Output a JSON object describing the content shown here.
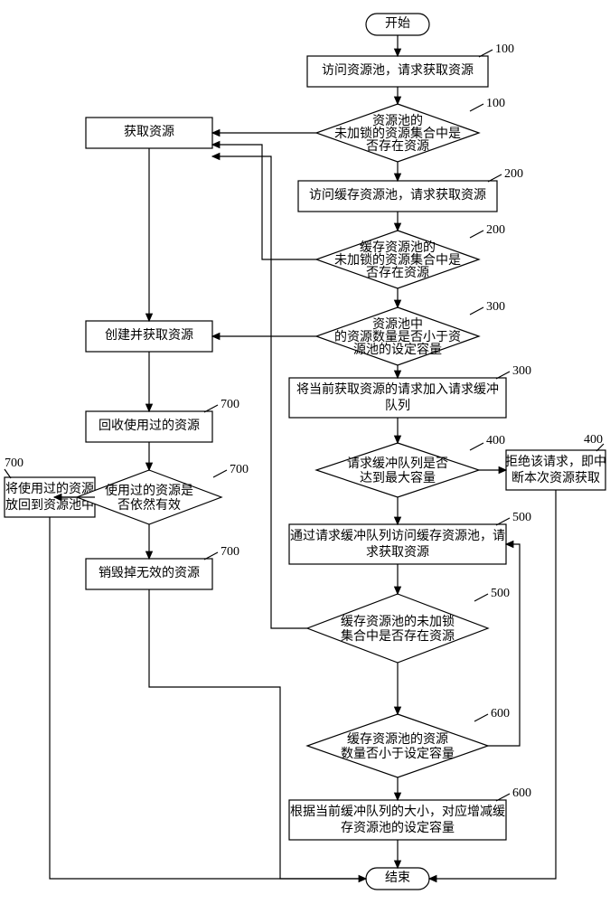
{
  "terminals": {
    "start": "开始",
    "end": "结束"
  },
  "boxes": {
    "b100_access": "访问资源池，请求获取资源",
    "b_get_resource": "获取资源",
    "b200_access": "访问缓存资源池，请求获取资源",
    "b_create_get": "创建并获取资源",
    "b300_queue": "将当前获取资源的请求加入请求缓冲\n队列",
    "b700_recycle": "回收使用过的资源",
    "b400_reject": "拒绝该请求，即中\n断本次资源获取",
    "b500_via_buffer": "通过请求缓冲队列访问缓存资源池，请\n求获取资源",
    "b700_putback": "将使用过的资源\n放回到资源池中",
    "b700_destroy": "销毁掉无效的资源",
    "b600_adjust": "根据当前缓冲队列的大小，对应增减缓\n存资源池的设定容量"
  },
  "decisions": {
    "d100": "资源池的\n未加锁的资源集合中是\n否存在资源",
    "d200": "缓存资源池的\n未加锁的资源集合中是\n否存在资源",
    "d300": "资源池中\n的资源数量是否小于资\n源池的设定容量",
    "d400": "请求缓冲队列是否\n达到最大容量",
    "d700_valid": "使用过的资源是\n否依然有效",
    "d500": "缓存资源池的未加锁\n集合中是否存在资源",
    "d600": "缓存资源池的资源\n数量否小于设定容量"
  },
  "step_labels": {
    "n100": "100",
    "n200": "200",
    "n300": "300",
    "n400": "400",
    "n500": "500",
    "n600": "600",
    "n700": "700"
  },
  "chart_data": {
    "type": "flowchart",
    "nodes": [
      {
        "id": "start",
        "kind": "terminal",
        "label_key": "terminals.start"
      },
      {
        "id": "b100_access",
        "kind": "process",
        "label_key": "boxes.b100_access",
        "step": "100"
      },
      {
        "id": "d100",
        "kind": "decision",
        "label_key": "decisions.d100",
        "step": "100"
      },
      {
        "id": "b_get_resource",
        "kind": "process",
        "label_key": "boxes.b_get_resource"
      },
      {
        "id": "b200_access",
        "kind": "process",
        "label_key": "boxes.b200_access",
        "step": "200"
      },
      {
        "id": "d200",
        "kind": "decision",
        "label_key": "decisions.d200",
        "step": "200"
      },
      {
        "id": "d300",
        "kind": "decision",
        "label_key": "decisions.d300",
        "step": "300"
      },
      {
        "id": "b_create_get",
        "kind": "process",
        "label_key": "boxes.b_create_get"
      },
      {
        "id": "b300_queue",
        "kind": "process",
        "label_key": "boxes.b300_queue",
        "step": "300"
      },
      {
        "id": "b700_recycle",
        "kind": "process",
        "label_key": "boxes.b700_recycle",
        "step": "700"
      },
      {
        "id": "d400",
        "kind": "decision",
        "label_key": "decisions.d400",
        "step": "400"
      },
      {
        "id": "b400_reject",
        "kind": "process",
        "label_key": "boxes.b400_reject",
        "step": "400"
      },
      {
        "id": "d700_valid",
        "kind": "decision",
        "label_key": "decisions.d700_valid",
        "step": "700"
      },
      {
        "id": "b500_via_buffer",
        "kind": "process",
        "label_key": "boxes.b500_via_buffer",
        "step": "500"
      },
      {
        "id": "b700_putback",
        "kind": "process",
        "label_key": "boxes.b700_putback",
        "step": "700"
      },
      {
        "id": "b700_destroy",
        "kind": "process",
        "label_key": "boxes.b700_destroy",
        "step": "700"
      },
      {
        "id": "d500",
        "kind": "decision",
        "label_key": "decisions.d500",
        "step": "500"
      },
      {
        "id": "d600",
        "kind": "decision",
        "label_key": "decisions.d600",
        "step": "600"
      },
      {
        "id": "b600_adjust",
        "kind": "process",
        "label_key": "boxes.b600_adjust",
        "step": "600"
      },
      {
        "id": "end",
        "kind": "terminal",
        "label_key": "terminals.end"
      }
    ],
    "edges": [
      {
        "from": "start",
        "to": "b100_access"
      },
      {
        "from": "b100_access",
        "to": "d100"
      },
      {
        "from": "d100",
        "to": "b_get_resource",
        "branch": "yes"
      },
      {
        "from": "d100",
        "to": "b200_access",
        "branch": "no"
      },
      {
        "from": "b200_access",
        "to": "d200"
      },
      {
        "from": "d200",
        "to": "b_get_resource",
        "branch": "yes"
      },
      {
        "from": "d200",
        "to": "d300",
        "branch": "no"
      },
      {
        "from": "d300",
        "to": "b_create_get",
        "branch": "yes"
      },
      {
        "from": "d300",
        "to": "b300_queue",
        "branch": "no"
      },
      {
        "from": "b_create_get",
        "to": "b700_recycle"
      },
      {
        "from": "b_get_resource",
        "to": "b700_recycle"
      },
      {
        "from": "b300_queue",
        "to": "d400"
      },
      {
        "from": "d400",
        "to": "b400_reject",
        "branch": "yes"
      },
      {
        "from": "d400",
        "to": "b500_via_buffer",
        "branch": "no"
      },
      {
        "from": "b700_recycle",
        "to": "d700_valid"
      },
      {
        "from": "d700_valid",
        "to": "b700_putback",
        "branch": "yes"
      },
      {
        "from": "d700_valid",
        "to": "b700_destroy",
        "branch": "no"
      },
      {
        "from": "b500_via_buffer",
        "to": "d500"
      },
      {
        "from": "d500",
        "to": "b_get_resource",
        "branch": "yes"
      },
      {
        "from": "d500",
        "to": "d600",
        "branch": "no"
      },
      {
        "from": "d600",
        "to": "b600_adjust",
        "branch": "yes"
      },
      {
        "from": "d600",
        "to": "b500_via_buffer",
        "branch": "no"
      },
      {
        "from": "b600_adjust",
        "to": "end"
      },
      {
        "from": "b700_putback",
        "to": "end"
      },
      {
        "from": "b700_destroy",
        "to": "end"
      },
      {
        "from": "b400_reject",
        "to": "end"
      }
    ]
  }
}
